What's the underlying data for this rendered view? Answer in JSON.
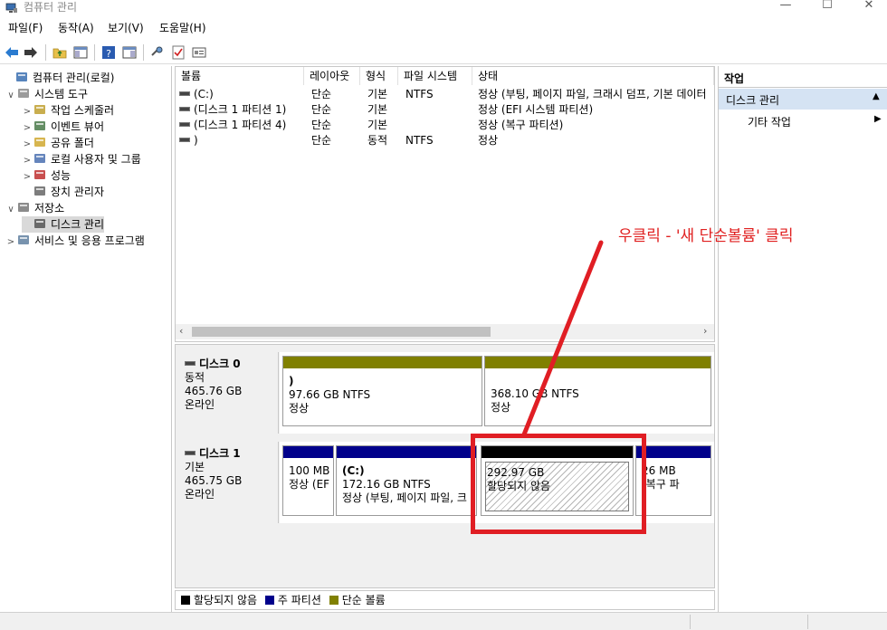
{
  "window": {
    "title": "컴퓨터 관리",
    "controls": {
      "minimize": "—",
      "maximize": "☐",
      "close": "✕"
    }
  },
  "menu": [
    "파일(F)",
    "동작(A)",
    "보기(V)",
    "도움말(H)"
  ],
  "tree": [
    {
      "label": "컴퓨터 관리(로컬)",
      "level": 0,
      "expander": "",
      "icon": "computer-management-icon"
    },
    {
      "label": "시스템 도구",
      "level": 1,
      "expander": "∨",
      "icon": "system-tools-icon"
    },
    {
      "label": "작업 스케줄러",
      "level": 2,
      "expander": ">",
      "icon": "clock-icon"
    },
    {
      "label": "이벤트 뷰어",
      "level": 2,
      "expander": ">",
      "icon": "event-viewer-icon"
    },
    {
      "label": "공유 폴더",
      "level": 2,
      "expander": ">",
      "icon": "shared-folder-icon"
    },
    {
      "label": "로컬 사용자 및 그룹",
      "level": 2,
      "expander": ">",
      "icon": "users-icon"
    },
    {
      "label": "성능",
      "level": 2,
      "expander": ">",
      "icon": "performance-icon"
    },
    {
      "label": "장치 관리자",
      "level": 2,
      "expander": "",
      "icon": "device-manager-icon"
    },
    {
      "label": "저장소",
      "level": 1,
      "expander": "∨",
      "icon": "storage-icon"
    },
    {
      "label": "디스크 관리",
      "level": 2,
      "expander": "",
      "icon": "disk-management-icon",
      "selected": true
    },
    {
      "label": "서비스 및 응용 프로그램",
      "level": 1,
      "expander": ">",
      "icon": "services-icon"
    }
  ],
  "volume_table": {
    "columns": [
      "볼륨",
      "레이아웃",
      "형식",
      "파일 시스템",
      "상태"
    ],
    "rows": [
      {
        "volume": "(C:)",
        "layout": "단순",
        "type": "기본",
        "fs": "NTFS",
        "status": "정상 (부팅, 페이지 파일, 크래시 덤프, 기본 데이터"
      },
      {
        "volume": "(디스크 1 파티션 1)",
        "layout": "단순",
        "type": "기본",
        "fs": "",
        "status": "정상 (EFI 시스템 파티션)"
      },
      {
        "volume": "(디스크 1 파티션 4)",
        "layout": "단순",
        "type": "기본",
        "fs": "",
        "status": "정상 (복구 파티션)"
      },
      {
        "volume": ")",
        "layout": "단순",
        "type": "동적",
        "fs": "NTFS",
        "status": "정상"
      }
    ]
  },
  "disks": [
    {
      "name": "디스크 0",
      "kind": "동적",
      "size": "465.76 GB",
      "state": "온라인",
      "partitions": [
        {
          "title": ")",
          "size": "97.66 GB NTFS",
          "status": "정상",
          "kind": "simple"
        },
        {
          "title": "",
          "size": "368.10 GB NTFS",
          "status": "정상",
          "kind": "simple"
        }
      ]
    },
    {
      "name": "디스크 1",
      "kind": "기본",
      "size": "465.75 GB",
      "state": "온라인",
      "partitions": [
        {
          "title": "",
          "size": "100 MB",
          "status": "정상 (EF",
          "kind": "primary"
        },
        {
          "title": "(C:)",
          "size": "172.16 GB NTFS",
          "status": "정상 (부팅, 페이지 파일, 크",
          "kind": "primary"
        },
        {
          "title": "",
          "size": "292.97 GB",
          "status": "할당되지 않음",
          "kind": "unallocated"
        },
        {
          "title": "",
          "size": "26 MB",
          "status": "(복구 파",
          "kind": "primary"
        }
      ]
    }
  ],
  "legend": [
    {
      "label": "할당되지 않음",
      "color": "#000000"
    },
    {
      "label": "주 파티션",
      "color": "#00008b"
    },
    {
      "label": "단순 볼륨",
      "color": "#808000"
    }
  ],
  "actions": {
    "header": "작업",
    "section": "디스크 관리",
    "item": "기타 작업"
  },
  "annotation": {
    "text": "우클릭 - '새 단순볼륨'  클릭",
    "color": "#e01e24"
  }
}
